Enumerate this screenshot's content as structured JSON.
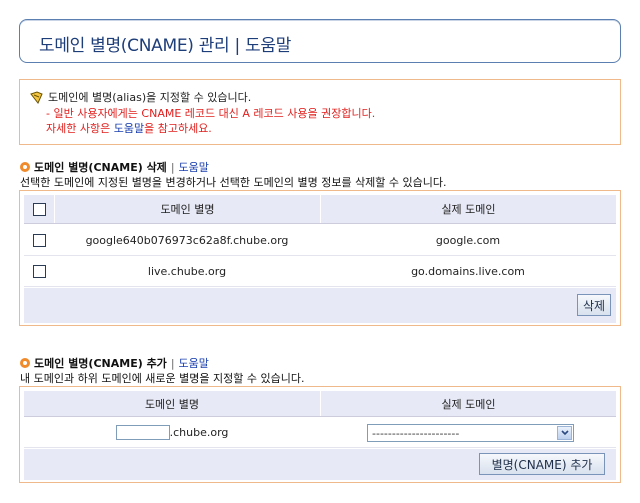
{
  "page": {
    "title": "도메인 별명(CNAME) 관리 | 도움말"
  },
  "notice": {
    "line1": "도메인에 별명(alias)을 지정할 수 있습니다.",
    "line2": "- 일반 사용자에게는 CNAME 레코드 대신 A 레코드 사용을 권장합니다.",
    "line3_pre": "자세한 사항은 ",
    "line3_link": "도움말",
    "line3_post": "을 참고하세요.",
    "icon": "pencil-note-icon"
  },
  "delete_section": {
    "title": "도메인 별명(CNAME) 삭제",
    "separator": "|",
    "help": "도움말",
    "description": "선택한 도메인에 지정된 별명을 변경하거나 선택한 도메인의 별명 정보를 삭제할 수 있습니다.",
    "columns": [
      "도메인 별명",
      "실제 도메인"
    ],
    "rows": [
      {
        "alias": "google640b076973c62a8f.chube.org",
        "target": "google.com"
      },
      {
        "alias": "live.chube.org",
        "target": "go.domains.live.com"
      }
    ],
    "delete_button": "삭제"
  },
  "add_section": {
    "title": "도메인 별명(CNAME) 추가",
    "separator": "|",
    "help": "도움말",
    "description": "내 도메인과 하위 도메인에 새로운 별명을 지정할 수 있습니다.",
    "columns": [
      "도메인 별명",
      "실제 도메인"
    ],
    "alias_input_value": "",
    "alias_suffix": ".chube.org",
    "target_select_value": "----------------------",
    "add_button": "별명(CNAME) 추가"
  },
  "colors": {
    "border_orange": "#f0b98c",
    "title_blue": "#1e3e7a",
    "warning_red": "#e0201e",
    "link_blue": "#1a3fae",
    "header_bg": "#e7e9f6"
  }
}
